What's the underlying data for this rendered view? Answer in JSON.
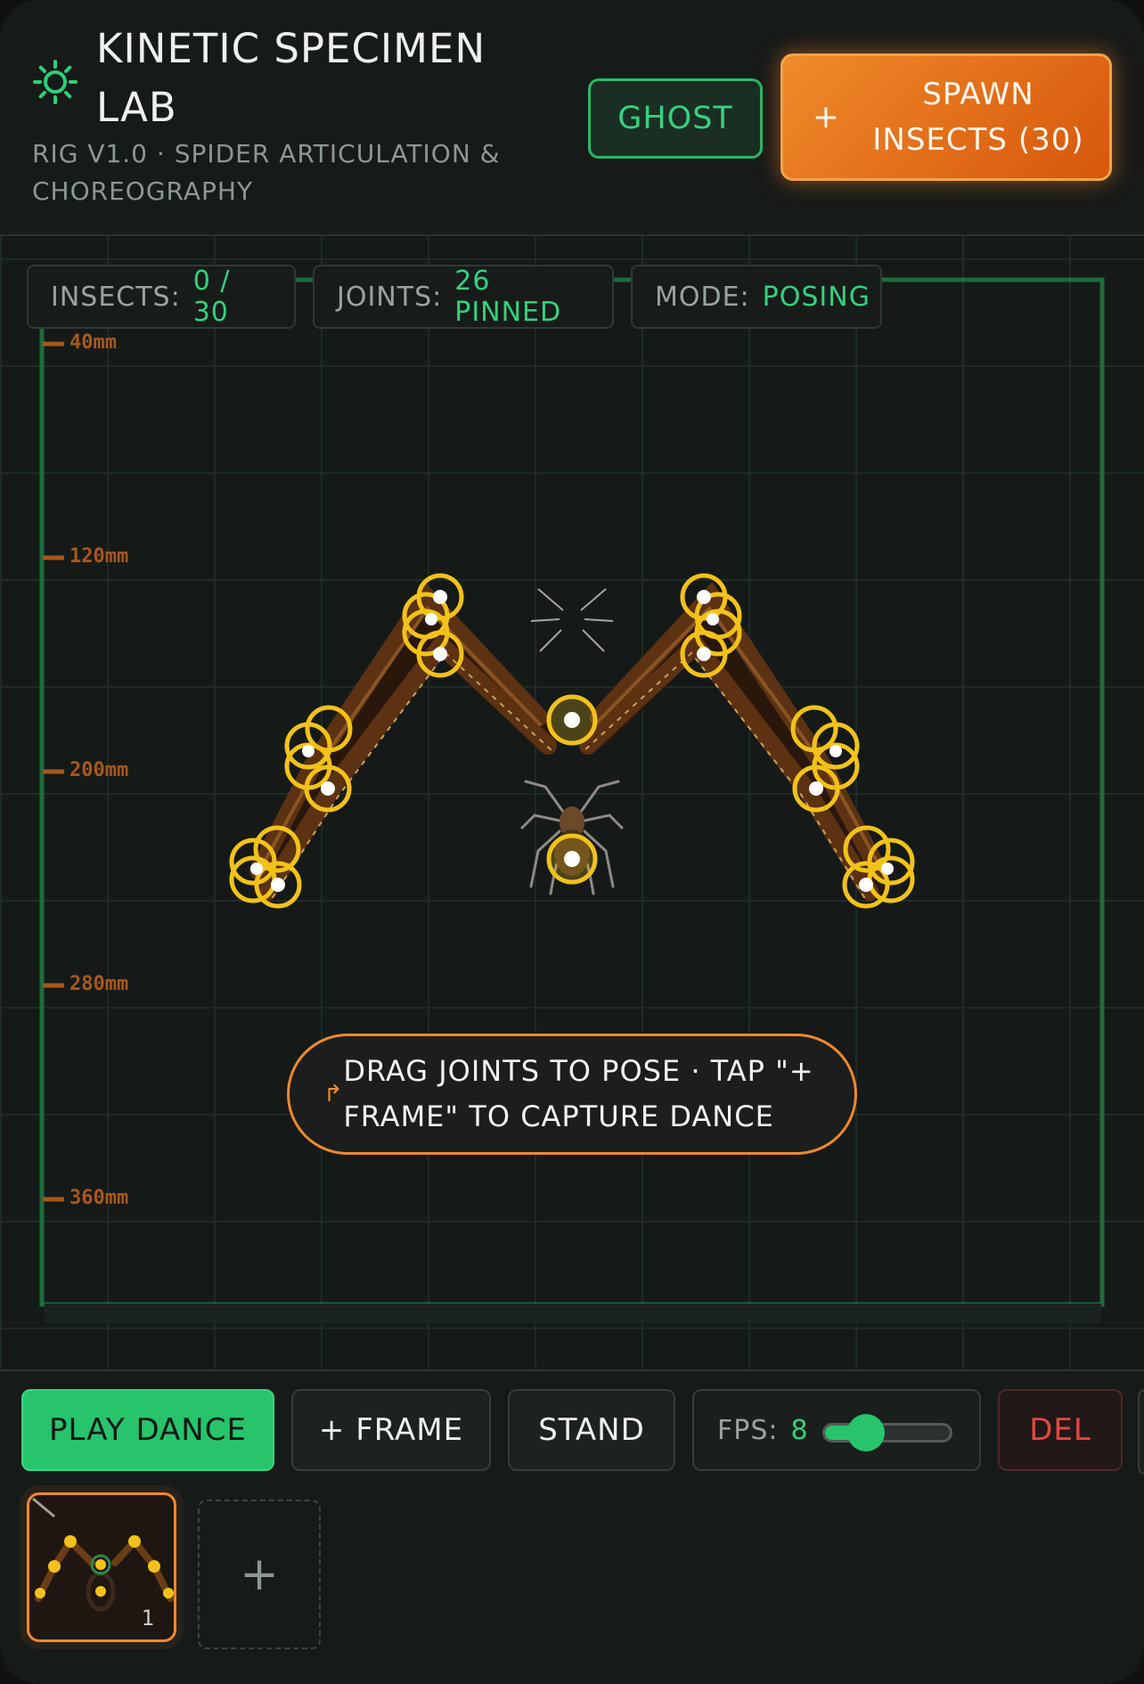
{
  "header": {
    "title": "KINETIC SPECIMEN LAB",
    "subtitle": "RIG V1.0 · SPIDER ARTICULATION & CHOREOGRAPHY",
    "ghost_label": "GHOST",
    "spawn_plus": "+",
    "spawn_label": "SPAWN INSECTS (30)",
    "icons": {
      "logo": "sun-gear-icon"
    }
  },
  "status": {
    "insects_key": "INSECTS:",
    "insects_val": "0 / 30",
    "joints_key": "JOINTS:",
    "joints_val": "26 PINNED",
    "mode_key": "MODE:",
    "mode_val": "POSING"
  },
  "ruler": {
    "labels": [
      "40mm",
      "120mm",
      "200mm",
      "280mm",
      "360mm"
    ]
  },
  "hint": {
    "icon": "↱",
    "text": "DRAG JOINTS TO POSE · TAP \"+ FRAME\" TO CAPTURE DANCE"
  },
  "toolbar": {
    "play_label": "PLAY DANCE",
    "frame_label": "+ FRAME",
    "stand_label": "STAND",
    "fps_key": "FPS:",
    "fps_val": "8",
    "fps_fraction": 0.33,
    "del_label": "DEL"
  },
  "timeline": {
    "frames": [
      {
        "number": "1"
      }
    ],
    "add_label": "+"
  },
  "colors": {
    "accent_green": "#27c46c",
    "accent_orange": "#f0882d",
    "joint_yellow": "#f2c21a",
    "danger_red": "#e0493f"
  }
}
